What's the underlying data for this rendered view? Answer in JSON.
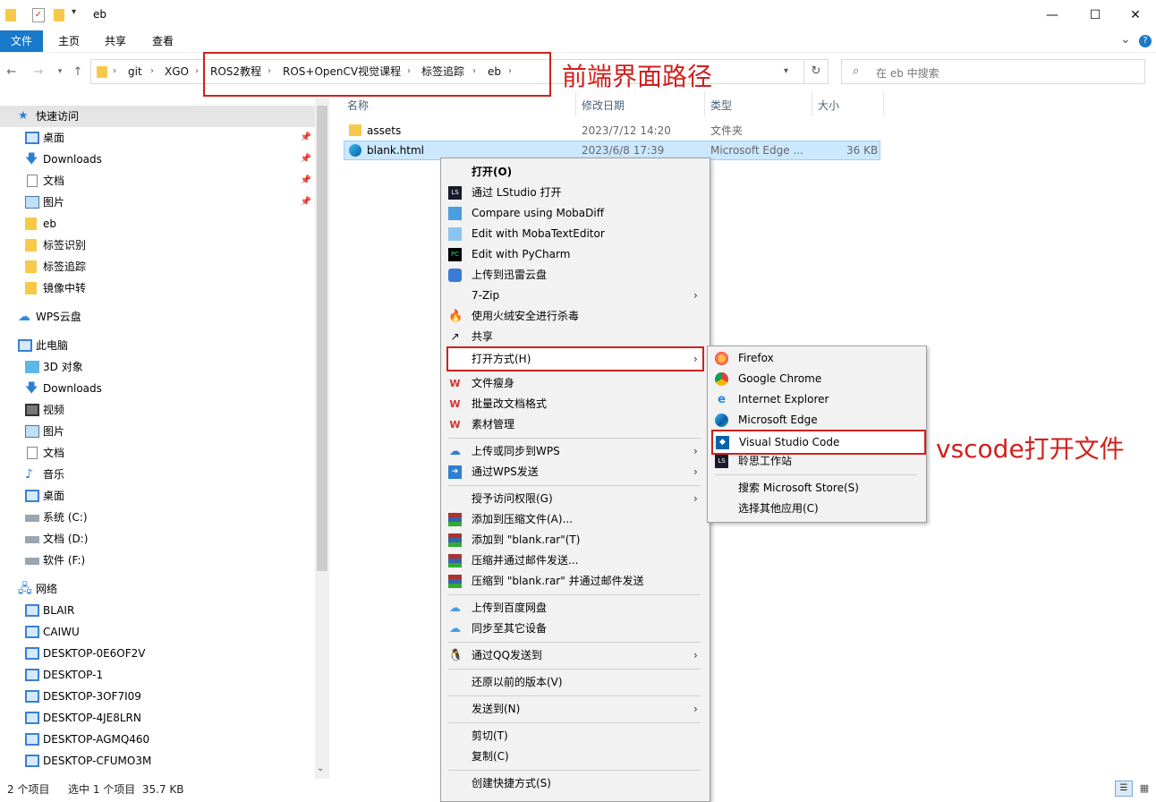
{
  "titlebar": {
    "title": "eb",
    "min": "—",
    "max": "☐",
    "close": "✕"
  },
  "ribbon": {
    "tabs": [
      "文件",
      "主页",
      "共享",
      "查看"
    ],
    "collapse": "⌄",
    "help": "?"
  },
  "address": {
    "crumbs": [
      "git",
      "XGO",
      "ROS2教程",
      "ROS+OpenCV视觉课程",
      "标签追踪",
      "eb"
    ]
  },
  "search": {
    "placeholder": "在 eb 中搜索"
  },
  "nav": {
    "quick_access": "快速访问",
    "quick_items": [
      "桌面",
      "Downloads",
      "文档",
      "图片",
      "eb",
      "标签识别",
      "标签追踪",
      "镜像中转"
    ],
    "wps": "WPS云盘",
    "this_pc": "此电脑",
    "pc_items": [
      "3D 对象",
      "Downloads",
      "视频",
      "图片",
      "文档",
      "音乐",
      "桌面",
      "系统 (C:)",
      "文档 (D:)",
      "软件 (F:)"
    ],
    "network": "网络",
    "net_items": [
      "BLAIR",
      "CAIWU",
      "DESKTOP-0E6OF2V",
      "DESKTOP-1",
      "DESKTOP-3OF7I09",
      "DESKTOP-4JE8LRN",
      "DESKTOP-AGMQ460",
      "DESKTOP-CFUMO3M"
    ]
  },
  "columns": {
    "name": "名称",
    "date": "修改日期",
    "type": "类型",
    "size": "大小"
  },
  "files": [
    {
      "name": "assets",
      "date": "2023/7/12 14:20",
      "type": "文件夹",
      "size": ""
    },
    {
      "name": "blank.html",
      "date": "2023/6/8 17:39",
      "type": "Microsoft Edge ...",
      "size": "36 KB"
    }
  ],
  "context_menu": [
    "打开(O)",
    "通过 LStudio 打开",
    "Compare using MobaDiff",
    "Edit with MobaTextEditor",
    "Edit with PyCharm",
    "上传到迅雷云盘",
    "7-Zip",
    "使用火绒安全进行杀毒",
    "共享",
    "打开方式(H)",
    "文件瘦身",
    "批量改文档格式",
    "素材管理",
    "上传或同步到WPS",
    "通过WPS发送",
    "授予访问权限(G)",
    "添加到压缩文件(A)...",
    "添加到 \"blank.rar\"(T)",
    "压缩并通过邮件发送...",
    "压缩到 \"blank.rar\" 并通过邮件发送",
    "上传到百度网盘",
    "同步至其它设备",
    "通过QQ发送到",
    "还原以前的版本(V)",
    "发送到(N)",
    "剪切(T)",
    "复制(C)",
    "创建快捷方式(S)"
  ],
  "open_with_menu": [
    "Firefox",
    "Google Chrome",
    "Internet Explorer",
    "Microsoft Edge",
    "Visual Studio Code",
    "聆思工作站",
    "搜索 Microsoft Store(S)",
    "选择其他应用(C)"
  ],
  "annotations": {
    "path": "前端界面路径",
    "vscode": "vscode打开文件"
  },
  "status": {
    "count": "2 个项目",
    "selected": "选中 1 个项目  35.7 KB"
  },
  "colors": {
    "accent": "#1979ca",
    "annotation": "#d0211c",
    "selection": "#cce8ff"
  }
}
